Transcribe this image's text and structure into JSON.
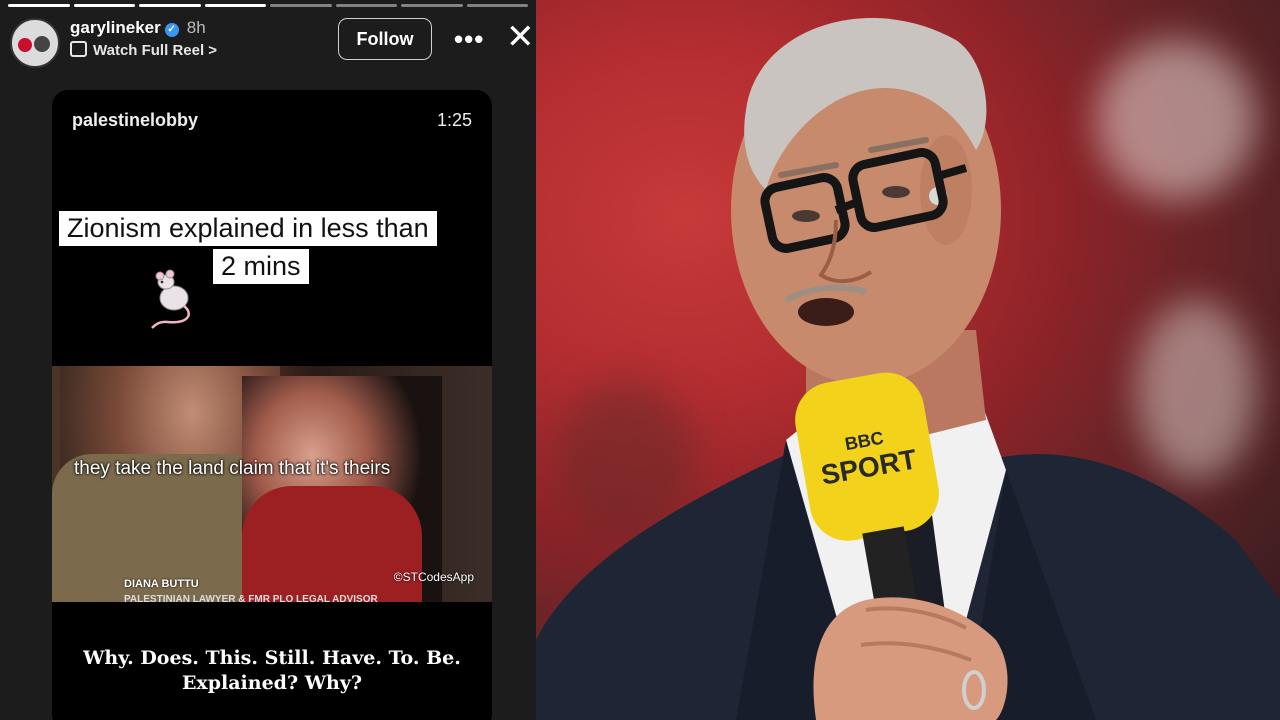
{
  "story": {
    "progress": [
      true,
      true,
      true,
      true,
      false,
      false,
      false,
      false
    ],
    "username": "garylineker",
    "verified": true,
    "time_ago": "8h",
    "watch_full_reel": "Watch Full Reel >",
    "follow_label": "Follow",
    "more_icon": "more-horizontal-icon",
    "close_icon": "close-icon",
    "reel_card": {
      "username": "palestinelobby",
      "duration": "1:25",
      "caption_line1": "Zionism explained in less than",
      "caption_line2": "2 mins",
      "video_subtitle": "they take the land claim that it's theirs",
      "speaker_name": "DIANA BUTTU",
      "speaker_title": "PALESTINIAN LAWYER & FMR PLO LEGAL ADVISOR",
      "credit": "©STCodesApp"
    },
    "quote_line1": "Why. Does. This. Still. Have. To. Be.",
    "quote_line2": "Explained? Why?"
  },
  "photo": {
    "microphone_brand_line1": "BBC",
    "microphone_brand_line2": "SPORT"
  }
}
